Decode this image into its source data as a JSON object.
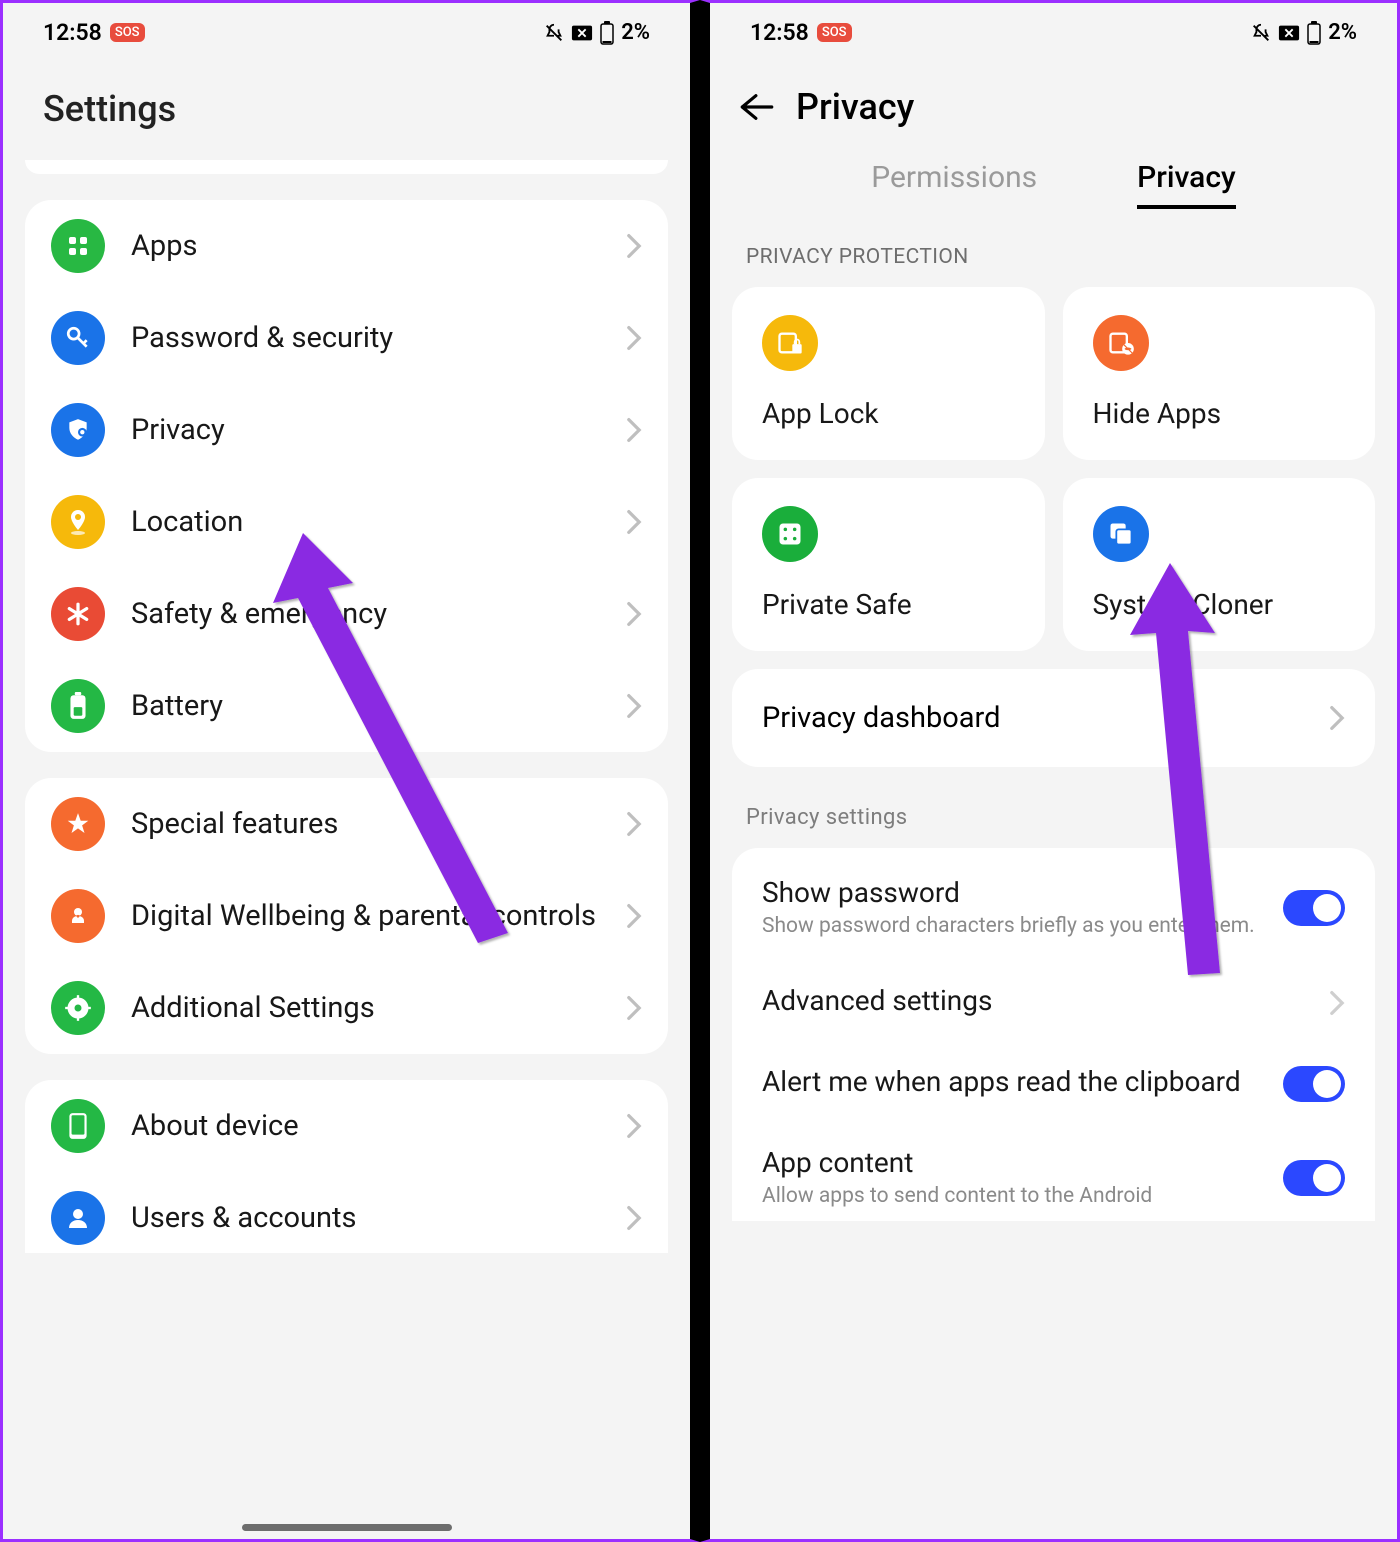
{
  "status": {
    "time": "12:58",
    "sos": "SOS",
    "battery": "2%"
  },
  "left": {
    "title": "Settings",
    "group1": [
      {
        "label": "Apps",
        "color": "#28b843",
        "icon": "grid"
      },
      {
        "label": "Password & security",
        "color": "#1a73e8",
        "icon": "key"
      },
      {
        "label": "Privacy",
        "color": "#1a73e8",
        "icon": "shield"
      },
      {
        "label": "Location",
        "color": "#f6b90b",
        "icon": "pin"
      },
      {
        "label": "Safety & emergency",
        "color": "#e94b35",
        "icon": "asterisk"
      },
      {
        "label": "Battery",
        "color": "#24b845",
        "icon": "battery"
      }
    ],
    "group2": [
      {
        "label": "Special features",
        "color": "#f56a2f",
        "icon": "star"
      },
      {
        "label": "Digital Wellbeing & parental controls",
        "color": "#f56a2f",
        "icon": "heart"
      },
      {
        "label": "Additional Settings",
        "color": "#24b845",
        "icon": "gear"
      }
    ],
    "group3": [
      {
        "label": "About device",
        "color": "#24b845",
        "icon": "device"
      },
      {
        "label": "Users & accounts",
        "color": "#1a73e8",
        "icon": "user"
      }
    ]
  },
  "right": {
    "title": "Privacy",
    "tabs": {
      "inactive": "Permissions",
      "active": "Privacy"
    },
    "section1": "PRIVACY PROTECTION",
    "tiles": [
      {
        "label": "App Lock",
        "color": "#f6b90b"
      },
      {
        "label": "Hide Apps",
        "color": "#f56a2f"
      },
      {
        "label": "Private Safe",
        "color": "#1aae3b"
      },
      {
        "label": "System Cloner",
        "color": "#1a73e8"
      }
    ],
    "dashboard": "Privacy dashboard",
    "section2": "Privacy settings",
    "rows": {
      "show_password": {
        "title": "Show password",
        "sub": "Show password characters briefly as you enter them."
      },
      "advanced": {
        "title": "Advanced settings"
      },
      "clipboard": {
        "title": "Alert me when apps read the clipboard"
      },
      "app_content": {
        "title": "App content",
        "sub": "Allow apps to send content to the Android"
      }
    }
  }
}
